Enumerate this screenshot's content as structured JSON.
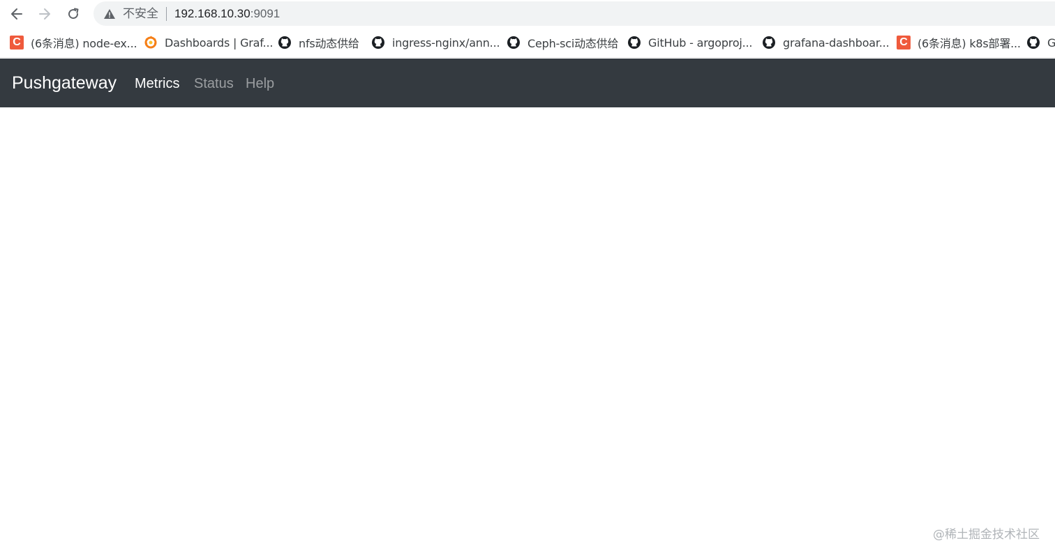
{
  "browser": {
    "back_icon": "arrow-left-icon",
    "forward_icon": "arrow-right-icon",
    "reload_icon": "reload-icon",
    "insecure_label": "不安全",
    "url_host": "192.168.10.30",
    "url_port": ":9091"
  },
  "bookmarks": [
    {
      "label": "(6条消息) node-ex...",
      "icon": "csdn-icon"
    },
    {
      "label": "Dashboards | Graf...",
      "icon": "grafana-icon"
    },
    {
      "label": "nfs动态供给",
      "icon": "github-icon"
    },
    {
      "label": "ingress-nginx/ann...",
      "icon": "github-icon"
    },
    {
      "label": "Ceph-sci动态供给",
      "icon": "github-icon"
    },
    {
      "label": "GitHub - argoproj...",
      "icon": "github-icon"
    },
    {
      "label": "grafana-dashboar...",
      "icon": "github-icon"
    },
    {
      "label": "(6条消息) k8s部署...",
      "icon": "csdn-icon"
    },
    {
      "label": "G",
      "icon": "github-icon"
    }
  ],
  "navbar": {
    "brand": "Pushgateway",
    "links": [
      {
        "label": "Metrics",
        "active": true
      },
      {
        "label": "Status",
        "active": false
      },
      {
        "label": "Help",
        "active": false
      }
    ],
    "background": "#343a40"
  },
  "watermark": "@稀土掘金技术社区",
  "colors": {
    "csdn": "#ef5a3c",
    "grafana": "#f57f17",
    "github": "#1b1f23"
  }
}
